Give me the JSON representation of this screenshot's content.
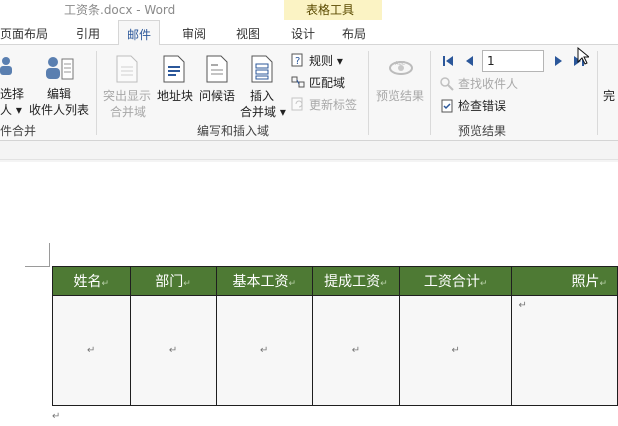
{
  "window": {
    "title": "工资条.docx - Word"
  },
  "context_tab_group": {
    "label": "表格工具"
  },
  "tabs": [
    {
      "label": "页面布局",
      "active": false
    },
    {
      "label": "引用",
      "active": false
    },
    {
      "label": "邮件",
      "active": true
    },
    {
      "label": "审阅",
      "active": false
    },
    {
      "label": "视图",
      "active": false
    },
    {
      "label": "设计",
      "active": false
    },
    {
      "label": "布局",
      "active": false
    }
  ],
  "ribbon": {
    "select_recipients": {
      "line1": "选择",
      "line2": "人 ▾"
    },
    "edit_recipients": {
      "line1": "编辑",
      "line2": "收件人列表"
    },
    "group_start_merge": "件合并",
    "highlight_fields": {
      "line1": "突出显示",
      "line2": "合并域"
    },
    "address_block": "地址块",
    "greeting_line": "问候语",
    "insert_field": {
      "line1": "插入",
      "line2": "合并域 ▾"
    },
    "rules": "规则 ▾",
    "match_fields": "匹配域",
    "update_labels": "更新标签",
    "group_write_insert": "编写和插入域",
    "preview_results": "预览结果",
    "record_number": "1",
    "find_recipient": "查找收件人",
    "check_errors": "检查错误",
    "group_preview": "预览结果",
    "finish": "完"
  },
  "table": {
    "headers": [
      "姓名",
      "部门",
      "基本工资",
      "提成工资",
      "工资合计",
      "照片"
    ],
    "cell_mark": "↵"
  },
  "paragraph_mark": "↵"
}
